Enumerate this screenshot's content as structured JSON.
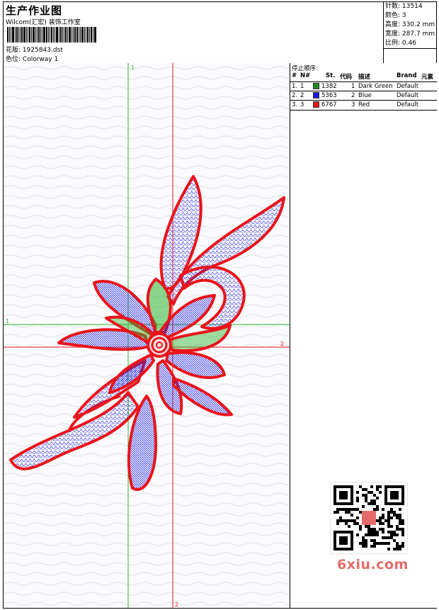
{
  "header": {
    "title": "生产作业图",
    "subtitle": "Wilcom(汇宏) 装饰工作室",
    "design_label": "花版:",
    "design_value": "1925843.dst",
    "colorway_label": "色位:",
    "colorway_value": "Colorway 1"
  },
  "stats": {
    "stitches_label": "针数:",
    "stitches_value": "13514",
    "colors_label": "颜色:",
    "colors_value": "3",
    "height_label": "高度:",
    "height_value": "330.2 mm",
    "width_label": "宽度:",
    "width_value": "287.7 mm",
    "scale_label": "比例:",
    "scale_value": "0.46"
  },
  "canvas": {
    "guide_green_v_label": "1",
    "guide_green_h_label": "1",
    "guide_red_h_label": "2",
    "guide_red_v_label": "2",
    "colors": {
      "green": "#2db52d",
      "red": "#e8141b",
      "blue": "#1520e0",
      "fill": "#e9e8f0"
    }
  },
  "stop_order": {
    "title": "停止顺序:",
    "columns": {
      "hash": "#",
      "n": "N#",
      "st": "St.",
      "code": "代码",
      "desc": "描述",
      "brand": "Brand",
      "elem": "元素"
    },
    "rows": [
      {
        "hash": "1.",
        "n": "1",
        "color": "#1e8a1e",
        "st": "1382",
        "code": "1",
        "desc": "Dark Green",
        "brand": "Default"
      },
      {
        "hash": "2.",
        "n": "2",
        "color": "#1a1ae0",
        "st": "5363",
        "code": "2",
        "desc": "Blue",
        "brand": "Default"
      },
      {
        "hash": "3.",
        "n": "3",
        "color": "#e01a1a",
        "st": "6767",
        "code": "3",
        "desc": "Red",
        "brand": "Default"
      }
    ]
  },
  "watermark": {
    "site": "6xiu.com",
    "accent": "#e56b6b",
    "qr_icon": "qr-code-icon"
  }
}
